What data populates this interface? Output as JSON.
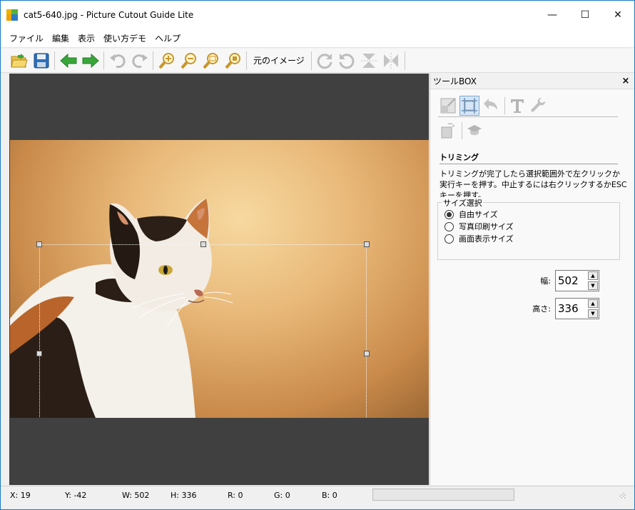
{
  "window": {
    "title": "cat5-640.jpg - Picture Cutout Guide Lite",
    "controls": {
      "minimize": "—",
      "maximize": "☐",
      "close": "✕"
    }
  },
  "menu": {
    "items": [
      "ファイル",
      "編集",
      "表示",
      "使い方デモ",
      "ヘルプ"
    ]
  },
  "toolbar": {
    "original_image_label": "元のイメージ",
    "icons": [
      "open-folder-icon",
      "save-icon",
      "back-arrow-icon",
      "forward-arrow-icon",
      "undo-icon",
      "redo-icon",
      "zoom-in-icon",
      "zoom-out-icon",
      "zoom-fit-icon",
      "zoom-actual-icon",
      "rotate-right-icon",
      "rotate-left-icon",
      "flip-vertical-icon",
      "flip-horizontal-icon"
    ]
  },
  "toolbox": {
    "title": "ツールBOX",
    "close_label": "×",
    "section_title": "トリミング",
    "description": "トリミングが完了したら選択範囲外で左クリックか実行キーを押す。中止するには右クリックするかESCキーを押す。",
    "size_group": {
      "label": "サイズ選択",
      "options": [
        {
          "label": "自由サイズ",
          "selected": true
        },
        {
          "label": "写真印刷サイズ",
          "selected": false
        },
        {
          "label": "画面表示サイズ",
          "selected": false
        }
      ]
    },
    "width": {
      "label": "幅:",
      "value": "502"
    },
    "height": {
      "label": "高さ:",
      "value": "336"
    }
  },
  "status": {
    "x": "X: 19",
    "y": "Y: -42",
    "w": "W: 502",
    "h": "H: 336",
    "r": "R: 0",
    "g": "G: 0",
    "b": "B: 0"
  },
  "colors": {
    "accent": "#1979ca",
    "canvas_bg": "#404040",
    "arrow_green": "#3aa53a"
  }
}
